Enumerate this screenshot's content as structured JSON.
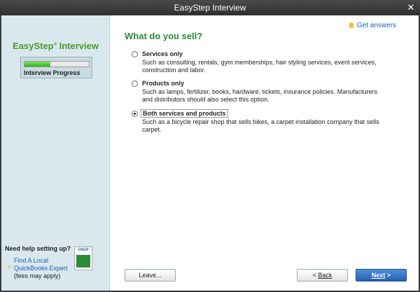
{
  "window": {
    "title": "EasyStep Interview",
    "close_glyph": "✕"
  },
  "sidebar": {
    "brand": "EasyStep",
    "brand_mark": "®",
    "brand_suffix": " Interview",
    "progress_label": "Interview Progress",
    "progress_fraction": 0.4,
    "help_title": "Need help setting up?",
    "help_link_line1": "Find A Local",
    "help_link_line2": "QuickBooks Expert",
    "help_fees": "(fees may apply)",
    "badge_label": "intuit"
  },
  "content": {
    "get_answers": "Get answers",
    "title": "What do you sell?",
    "options": [
      {
        "label": "Services only",
        "description": "Such as consulting, rentals, gym memberships, hair styling services, event services, construction and labor.",
        "checked": false
      },
      {
        "label": "Products only",
        "description": "Such as lamps, fertilizer, books, hardware, tickets, insurance policies. Manufacturers and distributors should also select this option.",
        "checked": false
      },
      {
        "label": "Both services and products",
        "description": "Such as a bicycle repair shop that sells bikes, a carpet installation company that sells carpet.",
        "checked": true
      }
    ]
  },
  "buttons": {
    "leave": "Leave...",
    "back_arrow": "< ",
    "back": "Back",
    "next": "Next",
    "next_arrow": " >"
  },
  "colors": {
    "accent_green": "#2c8a3a",
    "link_blue": "#1a5fb4",
    "sidebar_bg": "#d9e8ee",
    "next_button": "#2560b0"
  },
  "icons": [
    "close-icon",
    "bulb-icon",
    "bolt-icon",
    "intuit-badge"
  ]
}
